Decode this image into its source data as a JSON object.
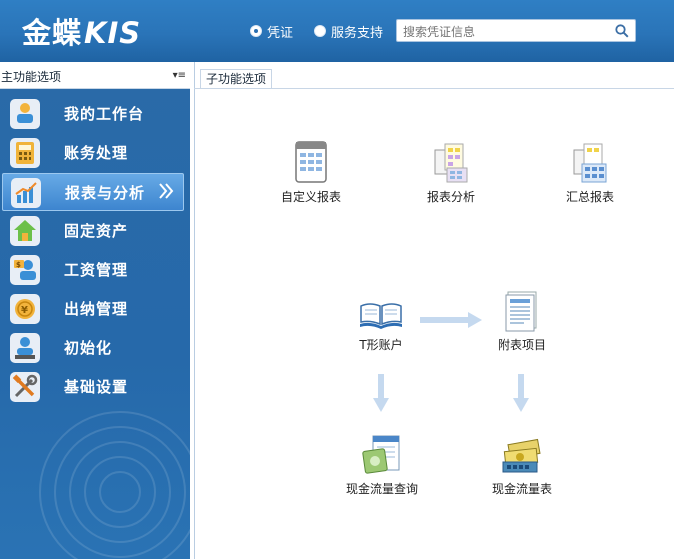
{
  "header": {
    "logo_cn": "金蝶",
    "logo_en": "KIS",
    "radio_voucher": "凭证",
    "radio_service": "服务支持",
    "search_placeholder": "搜索凭证信息",
    "accent_color": "#2a74b8"
  },
  "sidebar": {
    "title": "主功能选项",
    "items": [
      {
        "label": "我的工作台",
        "icon": "person-desk-icon"
      },
      {
        "label": "账务处理",
        "icon": "calculator-icon"
      },
      {
        "label": "报表与分析",
        "icon": "bar-chart-icon",
        "active": true
      },
      {
        "label": "固定资产",
        "icon": "house-icon"
      },
      {
        "label": "工资管理",
        "icon": "payroll-icon"
      },
      {
        "label": "出纳管理",
        "icon": "coin-icon"
      },
      {
        "label": "初始化",
        "icon": "init-user-icon"
      },
      {
        "label": "基础设置",
        "icon": "tools-icon"
      }
    ]
  },
  "main": {
    "title": "子功能选项",
    "functions": {
      "custom_report": "自定义报表",
      "report_analysis": "报表分析",
      "summary_report": "汇总报表",
      "t_account": "T形账户",
      "appendix_items": "附表项目",
      "cashflow_query": "现金流量查询",
      "cashflow_table": "现金流量表"
    }
  }
}
